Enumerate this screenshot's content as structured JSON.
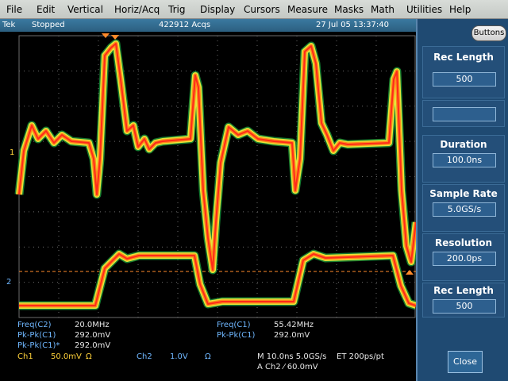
{
  "menu": [
    "File",
    "Edit",
    "Vertical",
    "Horiz/Acq",
    "Trig",
    "Display",
    "Cursors",
    "Measure",
    "Masks",
    "Math",
    "Utilities",
    "Help"
  ],
  "status": {
    "brand": "Tek",
    "state": "Stopped",
    "acqs": "422912 Acqs",
    "timestamp": "27 Jul 05 13:37:40"
  },
  "panel": {
    "buttons_label": "Buttons",
    "rec_length_title": "Rec Length",
    "rec_length_value": "500",
    "duration_title": "Duration",
    "duration_value": "100.0ns",
    "sample_rate_title": "Sample Rate",
    "sample_rate_value": "5.0GS/s",
    "resolution_title": "Resolution",
    "resolution_value": "200.0ps",
    "rec_length2_title": "Rec Length",
    "rec_length2_value": "500",
    "close_label": "Close"
  },
  "measurements": {
    "left": [
      {
        "label": "Freq(C2)",
        "value": "20.0MHz"
      },
      {
        "label": "Pk-Pk(C1)",
        "value": "292.0mV"
      },
      {
        "label": "Pk-Pk(C1)*",
        "value": "292.0mV"
      }
    ],
    "right": [
      {
        "label": "Freq(C1)",
        "value": "55.42MHz"
      },
      {
        "label": "Pk-Pk(C1)",
        "value": "292.0mV"
      }
    ]
  },
  "bottom": {
    "ch1_label": "Ch1",
    "ch1_scale": "50.0mV",
    "ch1_unit": "Ω",
    "ch2_label": "Ch2",
    "ch2_scale": "1.0V",
    "ch2_unit": "Ω",
    "timebase": "M 10.0ns 5.0GS/s",
    "et": "ET 200ps/pt",
    "trigger": "A Ch2 ⁄ 60.0mV"
  },
  "markers": {
    "ch1": "1",
    "ch2": "2"
  },
  "colors": {
    "panel": "#1f4a72",
    "status": "#2c5f80",
    "ch1_trace": "#ff9b1a",
    "ch2_trace": "#ff2a1a",
    "readout": "#6fb7ff"
  }
}
